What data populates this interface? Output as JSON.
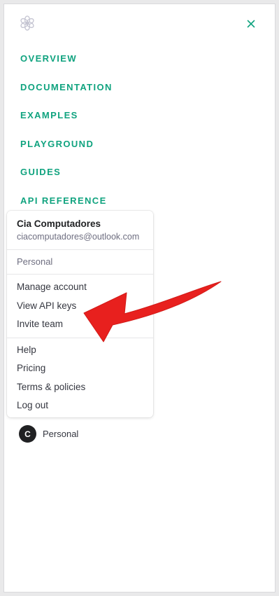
{
  "theme": {
    "accent": "#10a37f",
    "arrow_color": "#e8201e"
  },
  "header": {
    "logo_icon": "openai-logo-icon",
    "close_icon": "close-icon",
    "close_glyph": "×"
  },
  "nav": {
    "items": [
      {
        "label": "OVERVIEW"
      },
      {
        "label": "DOCUMENTATION"
      },
      {
        "label": "EXAMPLES"
      },
      {
        "label": "PLAYGROUND"
      },
      {
        "label": "GUIDES"
      },
      {
        "label": "API REFERENCE"
      }
    ]
  },
  "account_menu": {
    "user_name": "Cia Computadores",
    "user_email": "ciacomputadores@outlook.com",
    "organization": "Personal",
    "account_items": [
      {
        "label": "Manage account"
      },
      {
        "label": "View API keys"
      },
      {
        "label": "Invite team"
      }
    ],
    "general_items": [
      {
        "label": "Help"
      },
      {
        "label": "Pricing"
      },
      {
        "label": "Terms & policies"
      },
      {
        "label": "Log out"
      }
    ]
  },
  "org_switcher": {
    "avatar_letter": "C",
    "label": "Personal"
  },
  "annotation": {
    "icon": "red-arrow-annotation"
  }
}
